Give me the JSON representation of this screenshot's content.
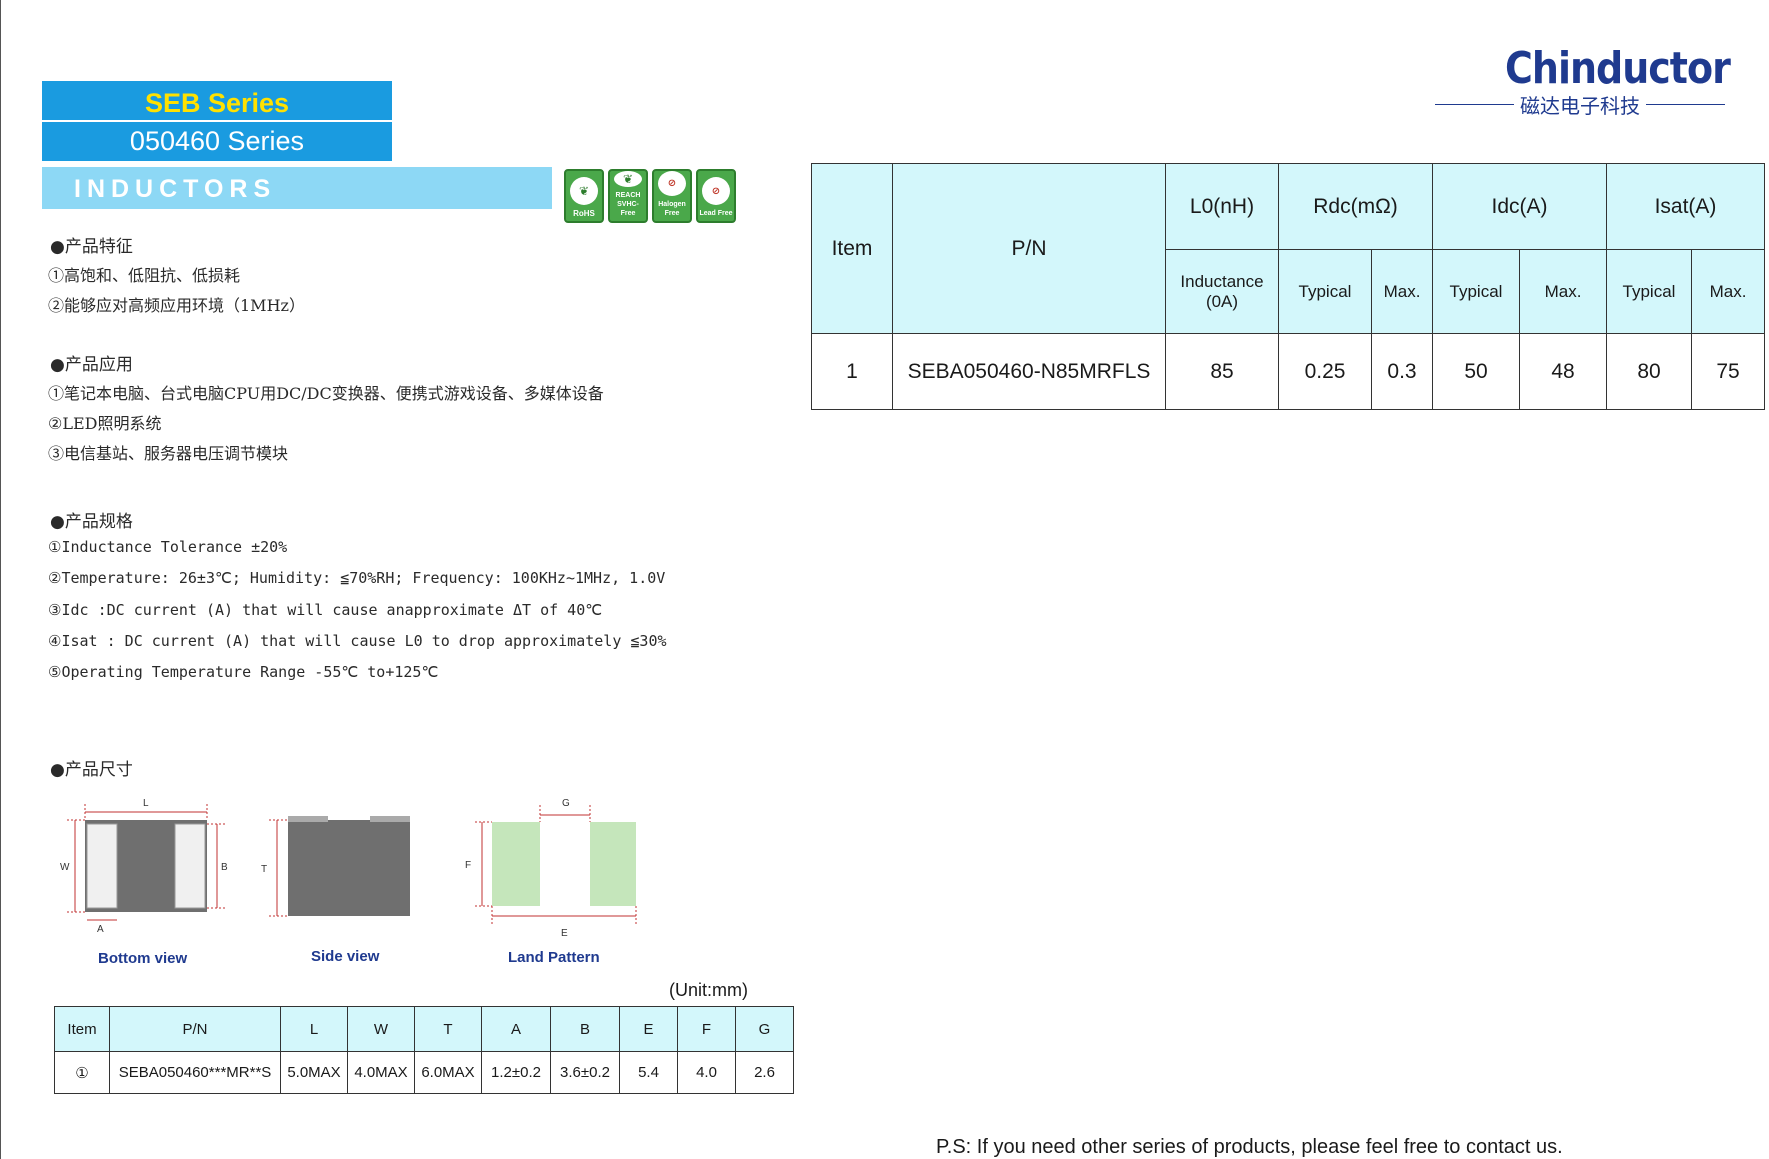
{
  "header": {
    "series_title": "SEB Series",
    "series_sub": "050460 Series",
    "category": "INDUCTORS",
    "badges": [
      {
        "label": "RoHS",
        "icon": "leaf-icon"
      },
      {
        "label": "REACH SVHC-Free",
        "icon": "leaf-icon"
      },
      {
        "label": "Halogen Free",
        "icon": "no-halogen-icon"
      },
      {
        "label": "Lead Free",
        "icon": "no-lead-icon"
      }
    ]
  },
  "logo": {
    "brand": "Chinductor",
    "company_cn": "磁达电子科技"
  },
  "features": {
    "title": "●产品特征",
    "items": [
      "①高饱和、低阻抗、低损耗",
      "②能够应对高频应用环境（1MHz）"
    ]
  },
  "applications": {
    "title": "●产品应用",
    "items": [
      "①笔记本电脑、台式电脑CPU用DC/DC变换器、便携式游戏设备、多媒体设备",
      "②LED照明系统",
      "③电信基站、服务器电压调节模块"
    ]
  },
  "specs": {
    "title": "●产品规格",
    "items": [
      "①Inductance Tolerance ±20%",
      "②Temperature: 26±3℃; Humidity: ≦70%RH; Frequency: 100KHz~1MHz, 1.0V",
      "③Idc :DC current (A) that will cause anapproximate ΔT of 40℃",
      "④Isat : DC current (A) that will cause L0 to drop approximately ≦30%",
      "⑤Operating Temperature Range -55℃ to+125℃"
    ]
  },
  "dimensions": {
    "title": "●产品尺寸",
    "labels": {
      "bottom_view": "Bottom view",
      "side_view": "Side view",
      "land_pattern": "Land Pattern",
      "L": "L",
      "W": "W",
      "B": "B",
      "A": "A",
      "T": "T",
      "F": "F",
      "G": "G",
      "E": "E"
    },
    "unit": "(Unit:mm)",
    "table": {
      "headers": [
        "Item",
        "P/N",
        "L",
        "W",
        "T",
        "A",
        "B",
        "E",
        "F",
        "G"
      ],
      "rows": [
        [
          "①",
          "SEBA050460***MR**S",
          "5.0MAX",
          "4.0MAX",
          "6.0MAX",
          "1.2±0.2",
          "3.6±0.2",
          "5.4",
          "4.0",
          "2.6"
        ]
      ]
    }
  },
  "main_table": {
    "headers": {
      "item": "Item",
      "pn": "P/N",
      "l0": "L0(nH)",
      "rdc": "Rdc(mΩ)",
      "idc": "Idc(A)",
      "isat": "Isat(A)",
      "inductance": "Inductance (0A)",
      "rdc_typ": "Typical",
      "rdc_max": "Max.",
      "idc_typ": "Typical",
      "idc_max": "Max.",
      "isat_typ": "Typical",
      "isat_max": "Max."
    },
    "rows": [
      {
        "item": "1",
        "pn": "SEBA050460-N85MRFLS",
        "l0": "85",
        "rdc_typ": "0.25",
        "rdc_max": "0.3",
        "idc_typ": "50",
        "idc_max": "48",
        "isat_typ": "80",
        "isat_max": "75"
      }
    ]
  },
  "footer": {
    "ps": "P.S: If you need other series of products, please feel free to contact us."
  }
}
